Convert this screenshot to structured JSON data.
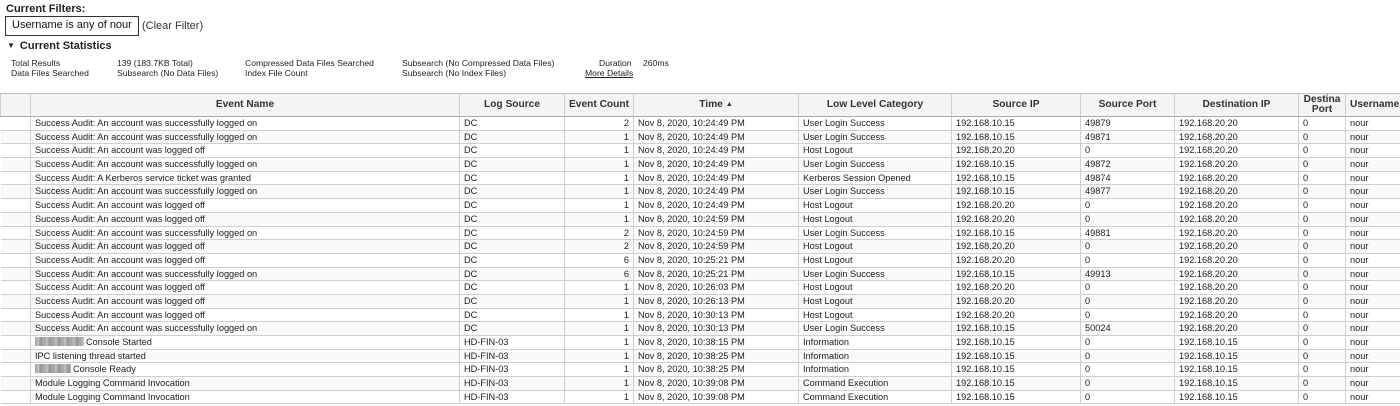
{
  "filters": {
    "label": "Current Filters:",
    "active_filter": "Username is any of nour",
    "clear_label": "(Clear Filter)"
  },
  "statistics": {
    "header": "Current Statistics",
    "items": {
      "total_results_label": "Total Results",
      "total_results_value": "139 (183.7KB Total)",
      "compressed_label": "Compressed Data Files Searched",
      "subsearch_compressed_label": "Subsearch (No Compressed Data Files)",
      "duration_label": "Duration",
      "duration_value": "260ms",
      "data_files_label": "Data Files Searched",
      "subsearch_data_label": "Subsearch (No Data Files)",
      "index_file_label": "Index File Count",
      "subsearch_index_label": "Subsearch (No Index Files)",
      "more_details": "More Details"
    }
  },
  "table": {
    "columns": [
      "",
      "Event Name",
      "Log Source",
      "Event Count",
      "Time",
      "Low Level Category",
      "Source IP",
      "Source Port",
      "Destination IP",
      "Destina Port",
      "Username"
    ],
    "sort": {
      "column": "Time",
      "direction": "ascending"
    },
    "rows": [
      {
        "event_name": "Success Audit: An account was successfully logged on",
        "redacted": false,
        "log_source": "DC",
        "event_count": "2",
        "time": "Nov 8, 2020, 10:24:49 PM",
        "category": "User Login Success",
        "source_ip": "192.168.10.15",
        "source_port": "49879",
        "dest_ip": "192.168.20.20",
        "dest_port": "0",
        "username": "nour"
      },
      {
        "event_name": "Success Audit: An account was successfully logged on",
        "redacted": false,
        "log_source": "DC",
        "event_count": "1",
        "time": "Nov 8, 2020, 10:24:49 PM",
        "category": "User Login Success",
        "source_ip": "192.168.10.15",
        "source_port": "49871",
        "dest_ip": "192.168.20.20",
        "dest_port": "0",
        "username": "nour"
      },
      {
        "event_name": "Success Audit: An account was logged off",
        "redacted": false,
        "log_source": "DC",
        "event_count": "1",
        "time": "Nov 8, 2020, 10:24:49 PM",
        "category": "Host Logout",
        "source_ip": "192.168.20.20",
        "source_port": "0",
        "dest_ip": "192.168.20.20",
        "dest_port": "0",
        "username": "nour"
      },
      {
        "event_name": "Success Audit: An account was successfully logged on",
        "redacted": false,
        "log_source": "DC",
        "event_count": "1",
        "time": "Nov 8, 2020, 10:24:49 PM",
        "category": "User Login Success",
        "source_ip": "192.168.10.15",
        "source_port": "49872",
        "dest_ip": "192.168.20.20",
        "dest_port": "0",
        "username": "nour"
      },
      {
        "event_name": "Success Audit: A Kerberos service ticket was granted",
        "redacted": false,
        "log_source": "DC",
        "event_count": "1",
        "time": "Nov 8, 2020, 10:24:49 PM",
        "category": "Kerberos Session Opened",
        "source_ip": "192.168.10.15",
        "source_port": "49874",
        "dest_ip": "192.168.20.20",
        "dest_port": "0",
        "username": "nour"
      },
      {
        "event_name": "Success Audit: An account was successfully logged on",
        "redacted": false,
        "log_source": "DC",
        "event_count": "1",
        "time": "Nov 8, 2020, 10:24:49 PM",
        "category": "User Login Success",
        "source_ip": "192.168.10.15",
        "source_port": "49877",
        "dest_ip": "192.168.20.20",
        "dest_port": "0",
        "username": "nour"
      },
      {
        "event_name": "Success Audit: An account was logged off",
        "redacted": false,
        "log_source": "DC",
        "event_count": "1",
        "time": "Nov 8, 2020, 10:24:49 PM",
        "category": "Host Logout",
        "source_ip": "192.168.20.20",
        "source_port": "0",
        "dest_ip": "192.168.20.20",
        "dest_port": "0",
        "username": "nour"
      },
      {
        "event_name": "Success Audit: An account was logged off",
        "redacted": false,
        "log_source": "DC",
        "event_count": "1",
        "time": "Nov 8, 2020, 10:24:59 PM",
        "category": "Host Logout",
        "source_ip": "192.168.20.20",
        "source_port": "0",
        "dest_ip": "192.168.20.20",
        "dest_port": "0",
        "username": "nour"
      },
      {
        "event_name": "Success Audit: An account was successfully logged on",
        "redacted": false,
        "log_source": "DC",
        "event_count": "2",
        "time": "Nov 8, 2020, 10:24:59 PM",
        "category": "User Login Success",
        "source_ip": "192.168.10.15",
        "source_port": "49881",
        "dest_ip": "192.168.20.20",
        "dest_port": "0",
        "username": "nour"
      },
      {
        "event_name": "Success Audit: An account was logged off",
        "redacted": false,
        "log_source": "DC",
        "event_count": "2",
        "time": "Nov 8, 2020, 10:24:59 PM",
        "category": "Host Logout",
        "source_ip": "192.168.20.20",
        "source_port": "0",
        "dest_ip": "192.168.20.20",
        "dest_port": "0",
        "username": "nour"
      },
      {
        "event_name": "Success Audit: An account was logged off",
        "redacted": false,
        "log_source": "DC",
        "event_count": "6",
        "time": "Nov 8, 2020, 10:25:21 PM",
        "category": "Host Logout",
        "source_ip": "192.168.20.20",
        "source_port": "0",
        "dest_ip": "192.168.20.20",
        "dest_port": "0",
        "username": "nour"
      },
      {
        "event_name": "Success Audit: An account was successfully logged on",
        "redacted": false,
        "log_source": "DC",
        "event_count": "6",
        "time": "Nov 8, 2020, 10:25:21 PM",
        "category": "User Login Success",
        "source_ip": "192.168.10.15",
        "source_port": "49913",
        "dest_ip": "192.168.20.20",
        "dest_port": "0",
        "username": "nour"
      },
      {
        "event_name": "Success Audit: An account was logged off",
        "redacted": false,
        "log_source": "DC",
        "event_count": "1",
        "time": "Nov 8, 2020, 10:26:03 PM",
        "category": "Host Logout",
        "source_ip": "192.168.20.20",
        "source_port": "0",
        "dest_ip": "192.168.20.20",
        "dest_port": "0",
        "username": "nour"
      },
      {
        "event_name": "Success Audit: An account was logged off",
        "redacted": false,
        "log_source": "DC",
        "event_count": "1",
        "time": "Nov 8, 2020, 10:26:13 PM",
        "category": "Host Logout",
        "source_ip": "192.168.20.20",
        "source_port": "0",
        "dest_ip": "192.168.20.20",
        "dest_port": "0",
        "username": "nour"
      },
      {
        "event_name": "Success Audit: An account was logged off",
        "redacted": false,
        "log_source": "DC",
        "event_count": "1",
        "time": "Nov 8, 2020, 10:30:13 PM",
        "category": "Host Logout",
        "source_ip": "192.168.20.20",
        "source_port": "0",
        "dest_ip": "192.168.20.20",
        "dest_port": "0",
        "username": "nour"
      },
      {
        "event_name": "Success Audit: An account was successfully logged on",
        "redacted": false,
        "log_source": "DC",
        "event_count": "1",
        "time": "Nov 8, 2020, 10:30:13 PM",
        "category": "User Login Success",
        "source_ip": "192.168.10.15",
        "source_port": "50024",
        "dest_ip": "192.168.20.20",
        "dest_port": "0",
        "username": "nour"
      },
      {
        "event_name": "Console Started",
        "redacted": true,
        "log_source": "HD-FIN-03",
        "event_count": "1",
        "time": "Nov 8, 2020, 10:38:15 PM",
        "category": "Information",
        "source_ip": "192.168.10.15",
        "source_port": "0",
        "dest_ip": "192.168.10.15",
        "dest_port": "0",
        "username": "nour"
      },
      {
        "event_name": "IPC listening thread started",
        "redacted": false,
        "log_source": "HD-FIN-03",
        "event_count": "1",
        "time": "Nov 8, 2020, 10:38:25 PM",
        "category": "Information",
        "source_ip": "192.168.10.15",
        "source_port": "0",
        "dest_ip": "192.168.10.15",
        "dest_port": "0",
        "username": "nour"
      },
      {
        "event_name": "Console Ready",
        "redacted": true,
        "log_source": "HD-FIN-03",
        "event_count": "1",
        "time": "Nov 8, 2020, 10:38:25 PM",
        "category": "Information",
        "source_ip": "192.168.10.15",
        "source_port": "0",
        "dest_ip": "192.168.10.15",
        "dest_port": "0",
        "username": "nour"
      },
      {
        "event_name": "Module Logging Command Invocation",
        "redacted": false,
        "log_source": "HD-FIN-03",
        "event_count": "1",
        "time": "Nov 8, 2020, 10:39:08 PM",
        "category": "Command Execution",
        "source_ip": "192.168.10.15",
        "source_port": "0",
        "dest_ip": "192.168.10.15",
        "dest_port": "0",
        "username": "nour"
      },
      {
        "event_name": "Module Logging Command Invocation",
        "redacted": false,
        "log_source": "HD-FIN-03",
        "event_count": "1",
        "time": "Nov 8, 2020, 10:39:08 PM",
        "category": "Command Execution",
        "source_ip": "192.168.10.15",
        "source_port": "0",
        "dest_ip": "192.168.10.15",
        "dest_port": "0",
        "username": "nour"
      }
    ]
  }
}
